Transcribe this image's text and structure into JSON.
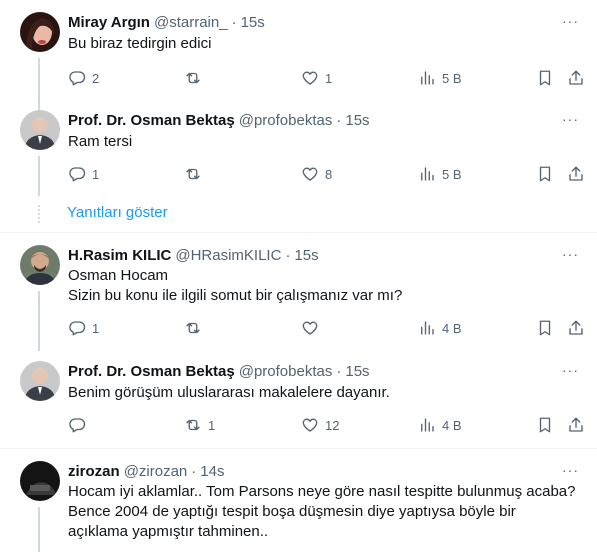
{
  "tweets": [
    {
      "name": "Miray Argın",
      "handle": "@starrain_",
      "dot": "·",
      "time": "15s",
      "lines": [
        "Bu biraz tedirgin edici"
      ],
      "replies": "2",
      "retweets": "",
      "likes": "1",
      "views": "5 B"
    },
    {
      "name": "Prof. Dr. Osman Bektaş",
      "handle": "@profobektas",
      "dot": "·",
      "time": "15s",
      "lines": [
        "Ram tersi"
      ],
      "replies": "1",
      "retweets": "",
      "likes": "8",
      "views": "5 B"
    },
    {
      "name": "H.Rasim KILIC",
      "handle": "@HRasimKILIC",
      "dot": "·",
      "time": "15s",
      "lines": [
        "Osman Hocam",
        "Sizin bu konu ile ilgili somut bir çalışmanız var mı?"
      ],
      "replies": "1",
      "retweets": "",
      "likes": "",
      "views": "4 B"
    },
    {
      "name": "Prof. Dr. Osman Bektaş",
      "handle": "@profobektas",
      "dot": "·",
      "time": "15s",
      "lines": [
        "Benim görüşüm uluslararası makalelere dayanır."
      ],
      "replies": "",
      "retweets": "1",
      "likes": "12",
      "views": "4 B"
    },
    {
      "name": "zirozan",
      "handle": "@zirozan",
      "dot": "·",
      "time": "14s",
      "lines": [
        "Hocam iyi aklamlar.. Tom Parsons neye göre nasıl tespitte bulunmuş acaba?",
        "Bence 2004 de yaptığı tespit boşa düşmesin diye yaptıysa böyle bir",
        "açıklama yapmıştır tahminen.."
      ],
      "replies": "",
      "retweets": "",
      "likes": "",
      "views": ""
    }
  ],
  "show_replies": "Yanıtları göster",
  "more_glyph": "···",
  "icons": {
    "reply": "reply-icon",
    "retweet": "retweet-icon",
    "like": "like-icon",
    "views": "views-icon",
    "bookmark": "bookmark-icon",
    "share": "share-icon",
    "more": "more-icon"
  },
  "colors": {
    "accent": "#1d9bf0",
    "text": "#0f1419",
    "secondary": "#536471",
    "divider": "#eff3f4",
    "thread_line": "#cfd9de"
  }
}
